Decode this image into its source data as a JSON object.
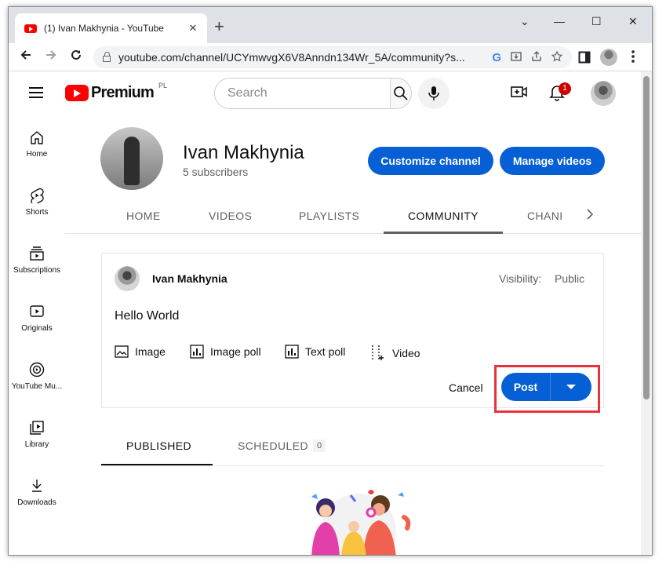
{
  "browser": {
    "tab_title": "(1) Ivan Makhynia - YouTube",
    "tab_close": "✕",
    "new_tab": "+",
    "url": "youtube.com/channel/UCYmwvgX6V8Anndn134Wr_5A/community?s...",
    "window_controls": [
      "⌄",
      "—",
      "☐",
      "✕"
    ]
  },
  "youtube": {
    "logo_text": "Premium",
    "country_code": "PL",
    "search_placeholder": "Search",
    "notification_count": "1"
  },
  "sidebar": {
    "items": [
      {
        "label": "Home",
        "icon": "home-icon"
      },
      {
        "label": "Shorts",
        "icon": "shorts-icon"
      },
      {
        "label": "Subscriptions",
        "icon": "subscriptions-icon"
      },
      {
        "label": "Originals",
        "icon": "originals-icon"
      },
      {
        "label": "YouTube Mu...",
        "icon": "youtube-music-icon"
      },
      {
        "label": "Library",
        "icon": "library-icon"
      },
      {
        "label": "Downloads",
        "icon": "download-icon"
      }
    ]
  },
  "channel": {
    "name": "Ivan Makhynia",
    "subscribers": "5 subscribers",
    "customize_label": "Customize channel",
    "manage_label": "Manage videos",
    "tabs": [
      "HOME",
      "VIDEOS",
      "PLAYLISTS",
      "COMMUNITY",
      "CHANI"
    ],
    "active_tab": "COMMUNITY"
  },
  "composer": {
    "author": "Ivan Makhynia",
    "visibility_label": "Visibility:",
    "visibility_value": "Public",
    "text": "Hello World",
    "attachments": [
      "Image",
      "Image poll",
      "Text poll",
      "Video"
    ],
    "cancel_label": "Cancel",
    "post_label": "Post"
  },
  "posts_tabs": {
    "published_label": "PUBLISHED",
    "scheduled_label": "SCHEDULED",
    "scheduled_count": "0"
  },
  "colors": {
    "primary_blue": "#065fd4",
    "youtube_red": "#ff0000",
    "highlight_red": "#e8323c"
  }
}
